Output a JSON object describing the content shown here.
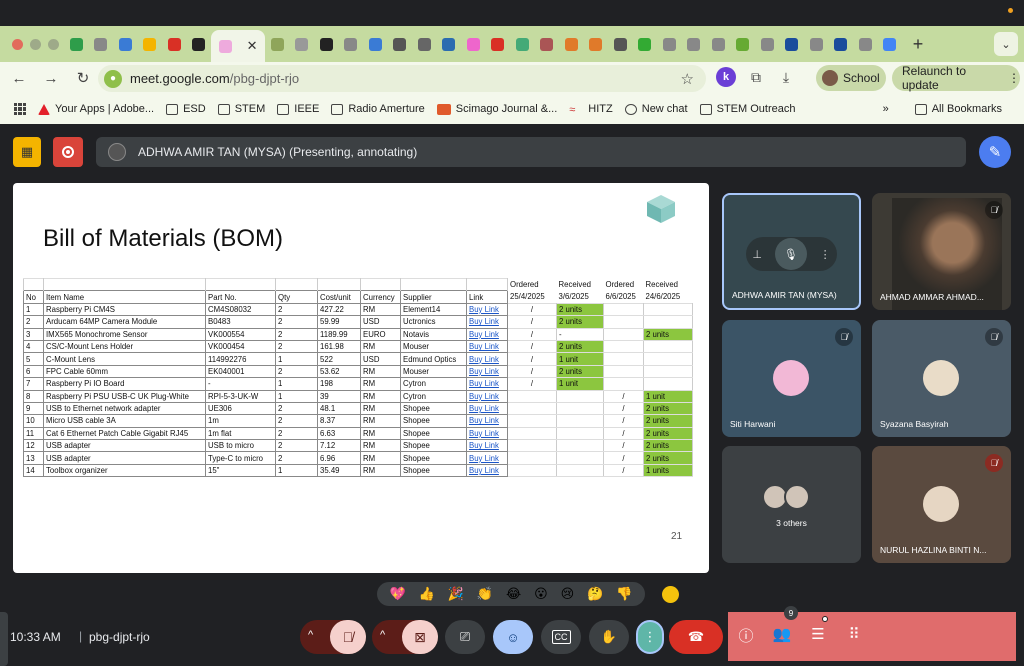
{
  "browser": {
    "url_host": "meet.google.com",
    "url_path": "/pbg-djpt-rjo",
    "profile_label": "School",
    "relaunch_label": "Relaunch to update",
    "extension_letter": "k"
  },
  "bookmarks": [
    {
      "label": "",
      "icon": "apps-grid-icon"
    },
    {
      "label": "Your Apps | Adobe...",
      "icon": "adobe-icon"
    },
    {
      "label": "ESD",
      "icon": "folder-icon"
    },
    {
      "label": "STEM",
      "icon": "folder-icon"
    },
    {
      "label": "IEEE",
      "icon": "folder-icon"
    },
    {
      "label": "Radio Amerture",
      "icon": "folder-icon"
    },
    {
      "label": "Scimago Journal &...",
      "icon": "sjr-icon"
    },
    {
      "label": "HITZ",
      "icon": "hitz-icon"
    },
    {
      "label": "New chat",
      "icon": "chat-icon"
    },
    {
      "label": "STEM Outreach",
      "icon": "folder-icon"
    }
  ],
  "bookmarks_more": "»",
  "all_bookmarks_label": "All Bookmarks",
  "meet": {
    "presenter_label": "ADHWA AMIR TAN (MYSA) (Presenting, annotating)",
    "slide": {
      "title": "Bill of Materials (BOM)",
      "page_number": "21",
      "top_headers": [
        "Ordered",
        "Received",
        "Ordered",
        "Received"
      ],
      "header": [
        "No",
        "Item Name",
        "Part No.",
        "Qty",
        "Cost/unit",
        "Currency",
        "Supplier",
        "Link",
        "25/4/2025",
        "3/6/2025",
        "6/6/2025",
        "24/6/2025"
      ],
      "rows": [
        [
          "1",
          "Raspberry Pi CM4S",
          "CM4S08032",
          "2",
          "427.22",
          "RM",
          "Element14",
          "Buy Link",
          "/",
          "2 units",
          "",
          ""
        ],
        [
          "2",
          "Arducam 64MP Camera Module",
          "B0483",
          "2",
          "59.99",
          "USD",
          "Uctronics",
          "Buy Link",
          "/",
          "2 units",
          "",
          ""
        ],
        [
          "3",
          "IMX565 Monochrome Sensor",
          "VK000554",
          "2",
          "1189.99",
          "EURO",
          "Notavis",
          "Buy Link",
          "/",
          "-",
          "",
          "2 units"
        ],
        [
          "4",
          "CS/C-Mount Lens Holder",
          "VK000454",
          "2",
          "161.98",
          "RM",
          "Mouser",
          "Buy Link",
          "/",
          "2 units",
          "",
          ""
        ],
        [
          "5",
          "C-Mount Lens",
          "114992276",
          "1",
          "522",
          "USD",
          "Edmund Optics",
          "Buy Link",
          "/",
          "1 unit",
          "",
          ""
        ],
        [
          "6",
          "FPC Cable 60mm",
          "EK040001",
          "2",
          "53.62",
          "RM",
          "Mouser",
          "Buy Link",
          "/",
          "2 units",
          "",
          ""
        ],
        [
          "7",
          "Raspberry Pi IO Board",
          "-",
          "1",
          "198",
          "RM",
          "Cytron",
          "Buy Link",
          "/",
          "1 unit",
          "",
          ""
        ],
        [
          "8",
          "Raspberry Pi PSU USB-C UK Plug-White",
          "RPI-5-3-UK-W",
          "1",
          "39",
          "RM",
          "Cytron",
          "Buy Link",
          "",
          "",
          "/",
          "1 unit"
        ],
        [
          "9",
          "USB to Ethernet network adapter",
          "UE306",
          "2",
          "48.1",
          "RM",
          "Shopee",
          "Buy Link",
          "",
          "",
          "/",
          "2 units"
        ],
        [
          "10",
          "Micro USB cable 3A",
          "1m",
          "2",
          "8.37",
          "RM",
          "Shopee",
          "Buy Link",
          "",
          "",
          "/",
          "2 units"
        ],
        [
          "11",
          "Cat 6 Ethernet Patch Cable Gigabit RJ45",
          "1m flat",
          "2",
          "6.63",
          "RM",
          "Shopee",
          "Buy Link",
          "",
          "",
          "/",
          "2 units"
        ],
        [
          "12",
          "USB adapter",
          "USB to micro",
          "2",
          "7.12",
          "RM",
          "Shopee",
          "Buy Link",
          "",
          "",
          "/",
          "2 units"
        ],
        [
          "13",
          "USB adapter",
          "Type-C to micro",
          "2",
          "6.96",
          "RM",
          "Shopee",
          "Buy Link",
          "",
          "",
          "/",
          "2 units"
        ],
        [
          "14",
          "Toolbox organizer",
          "15\"",
          "1",
          "35.49",
          "RM",
          "Shopee",
          "Buy Link",
          "",
          "",
          "/",
          "1 units"
        ]
      ]
    },
    "participants": [
      {
        "name": "ADHWA AMIR TAN (MYSA)"
      },
      {
        "name": "AHMAD AMMAR AHMAD..."
      },
      {
        "name": "Siti Harwani"
      },
      {
        "name": "Syazana Basyirah"
      },
      {
        "name": "3 others"
      },
      {
        "name": "NURUL HAZLINA BINTI N..."
      }
    ],
    "reactions": [
      "💖",
      "👍",
      "🎉",
      "👏",
      "😂",
      "😮",
      "😢",
      "🤔",
      "👎"
    ],
    "time": "10:33 AM",
    "meeting_code": "pbg-djpt-rjo",
    "people_count": "9"
  }
}
